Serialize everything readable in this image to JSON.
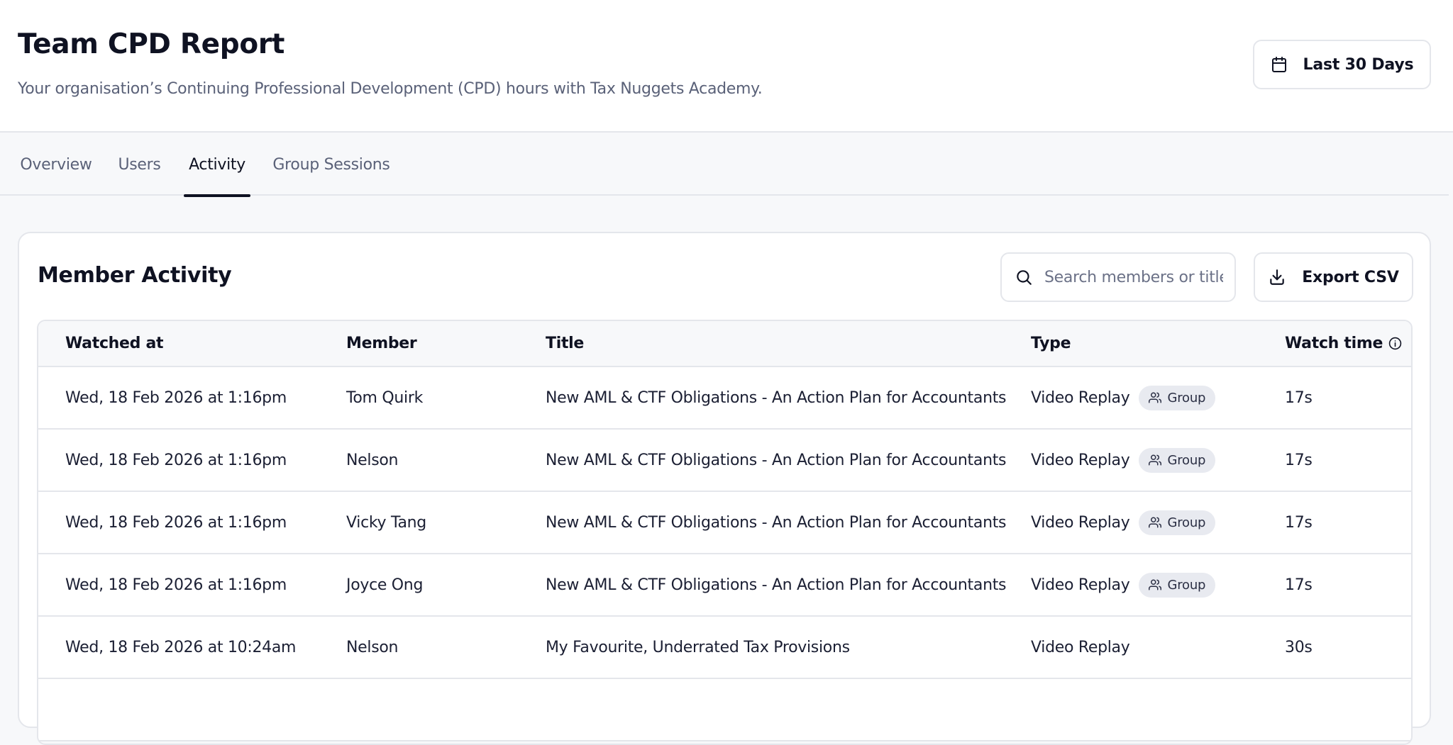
{
  "header": {
    "title": "Team CPD Report",
    "subtitle": "Your organisation’s Continuing Professional Development (CPD) hours with Tax Nuggets Academy.",
    "date_range_label": "Last 30 Days",
    "date_icon": "calendar-icon"
  },
  "tabs": [
    {
      "label": "Overview",
      "active": false
    },
    {
      "label": "Users",
      "active": false
    },
    {
      "label": "Activity",
      "active": true
    },
    {
      "label": "Group Sessions",
      "active": false
    }
  ],
  "activity": {
    "title": "Member Activity",
    "search": {
      "placeholder": "Search members or titles",
      "value": "",
      "icon": "search-icon"
    },
    "export_label": "Export CSV",
    "export_icon": "download-icon",
    "columns": [
      "Watched at",
      "Member",
      "Title",
      "Type",
      "Watch time"
    ],
    "watch_time_info_icon": "info-icon",
    "rows": [
      {
        "watched_at": "Wed, 18 Feb 2026 at 1:16pm",
        "member": "Tom Quirk",
        "title": "New AML & CTF Obligations - An Action Plan for Accountants",
        "type": "Video Replay",
        "badge": "Group",
        "watch_time": "17s"
      },
      {
        "watched_at": "Wed, 18 Feb 2026 at 1:16pm",
        "member": "Nelson",
        "title": "New AML & CTF Obligations - An Action Plan for Accountants",
        "type": "Video Replay",
        "badge": "Group",
        "watch_time": "17s"
      },
      {
        "watched_at": "Wed, 18 Feb 2026 at 1:16pm",
        "member": "Vicky Tang",
        "title": "New AML & CTF Obligations - An Action Plan for Accountants",
        "type": "Video Replay",
        "badge": "Group",
        "watch_time": "17s"
      },
      {
        "watched_at": "Wed, 18 Feb 2026 at 1:16pm",
        "member": "Joyce Ong",
        "title": "New AML & CTF Obligations - An Action Plan for Accountants",
        "type": "Video Replay",
        "badge": "Group",
        "watch_time": "17s"
      },
      {
        "watched_at": "Wed, 18 Feb 2026 at 10:24am",
        "member": "Nelson",
        "title": "My Favourite, Underrated Tax Provisions",
        "type": "Video Replay",
        "badge": "",
        "watch_time": "30s"
      }
    ]
  }
}
